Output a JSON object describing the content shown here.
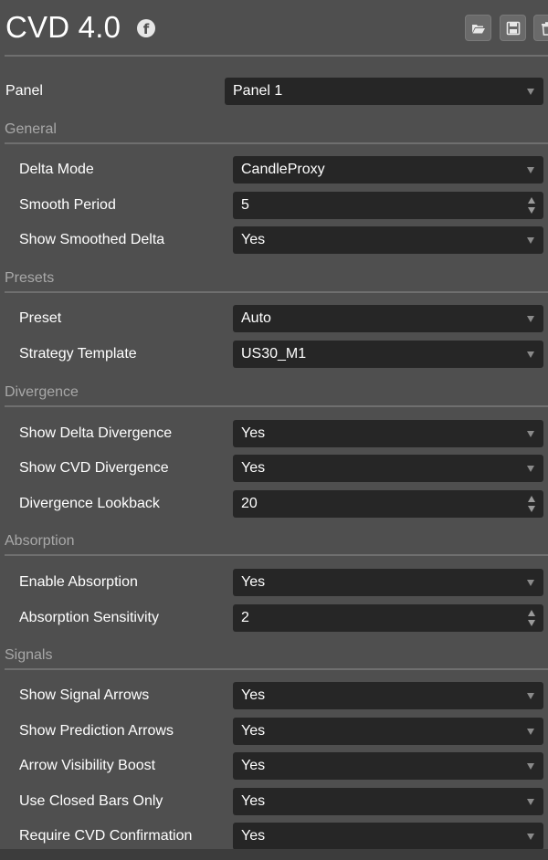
{
  "header": {
    "title": "CVD 4.0",
    "icons": [
      "facebook-icon",
      "folder-open-icon",
      "save-icon",
      "trash-icon"
    ]
  },
  "panel": {
    "label": "Panel",
    "value": "Panel 1"
  },
  "sections": {
    "general": {
      "title": "General",
      "delta_mode": {
        "label": "Delta Mode",
        "value": "CandleProxy"
      },
      "smooth_period": {
        "label": "Smooth Period",
        "value": "5"
      },
      "show_smoothed_delta": {
        "label": "Show Smoothed Delta",
        "value": "Yes"
      }
    },
    "presets": {
      "title": "Presets",
      "preset": {
        "label": "Preset",
        "value": "Auto"
      },
      "strategy_template": {
        "label": "Strategy Template",
        "value": "US30_M1"
      }
    },
    "divergence": {
      "title": "Divergence",
      "show_delta_divergence": {
        "label": "Show Delta Divergence",
        "value": "Yes"
      },
      "show_cvd_divergence": {
        "label": "Show CVD Divergence",
        "value": "Yes"
      },
      "divergence_lookback": {
        "label": "Divergence Lookback",
        "value": "20"
      }
    },
    "absorption": {
      "title": "Absorption",
      "enable_absorption": {
        "label": "Enable Absorption",
        "value": "Yes"
      },
      "absorption_sensitivity": {
        "label": "Absorption Sensitivity",
        "value": "2"
      }
    },
    "signals": {
      "title": "Signals",
      "show_signal_arrows": {
        "label": "Show Signal Arrows",
        "value": "Yes"
      },
      "show_prediction_arrows": {
        "label": "Show Prediction Arrows",
        "value": "Yes"
      },
      "arrow_visibility_boost": {
        "label": "Arrow Visibility Boost",
        "value": "Yes"
      },
      "use_closed_bars_only": {
        "label": "Use Closed Bars Only",
        "value": "Yes"
      },
      "require_cvd_confirmation": {
        "label": "Require CVD Confirmation",
        "value": "Yes"
      }
    }
  },
  "colors": {
    "background": "#4f4f4f",
    "field": "#262626",
    "section_text": "#a8a8a8",
    "divider": "#6f6f6f"
  }
}
